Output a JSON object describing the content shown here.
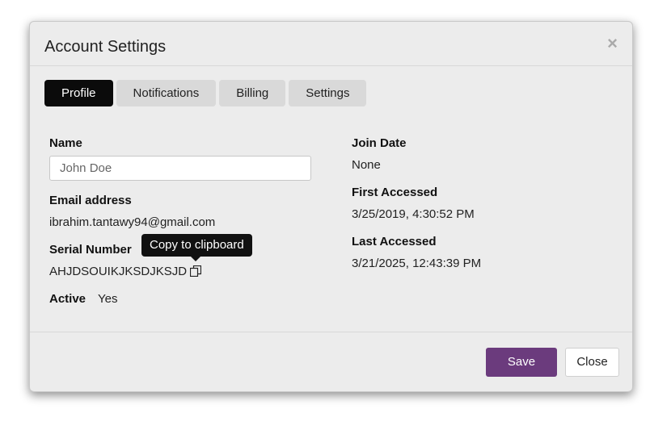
{
  "dialog": {
    "title": "Account Settings",
    "close_glyph": "×"
  },
  "tabs": [
    {
      "label": "Profile",
      "active": true
    },
    {
      "label": "Notifications",
      "active": false
    },
    {
      "label": "Billing",
      "active": false
    },
    {
      "label": "Settings",
      "active": false
    }
  ],
  "profile": {
    "name_label": "Name",
    "name_value": "John Doe",
    "email_label": "Email address",
    "email_value": "ibrahim.tantawy94@gmail.com",
    "serial_label": "Serial Number",
    "serial_value": "AHJDSOUIKJKSDJKSJD",
    "copy_tooltip": "Copy to clipboard",
    "active_label": "Active",
    "active_value": "Yes",
    "join_label": "Join Date",
    "join_value": "None",
    "first_label": "First Accessed",
    "first_value": "3/25/2019, 4:30:52 PM",
    "last_label": "Last Accessed",
    "last_value": "3/21/2025, 12:43:39 PM"
  },
  "footer": {
    "save_label": "Save",
    "close_label": "Close"
  },
  "colors": {
    "accent": "#6b3b7d",
    "active_tab": "#0b0b0b",
    "tooltip_bg": "#111111"
  },
  "icons": {
    "close": "close-icon",
    "copy": "copy-icon"
  }
}
